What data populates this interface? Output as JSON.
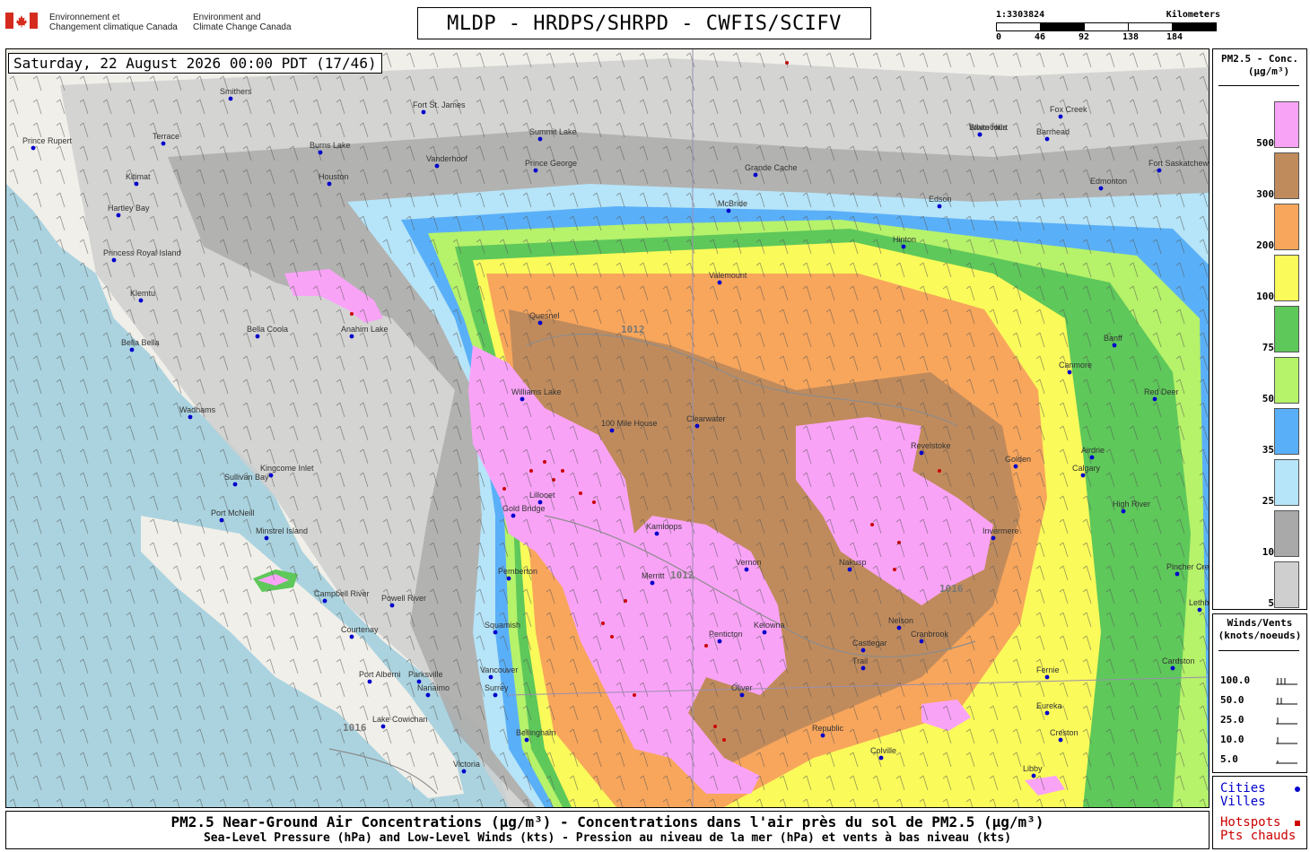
{
  "header": {
    "agency_fr_line1": "Environnement et",
    "agency_fr_line2": "Changement climatique Canada",
    "agency_en_line1": "Environment and",
    "agency_en_line2": "Climate Change Canada",
    "title": "MLDP - HRDPS/SHRPD - CWFIS/SCIFV"
  },
  "scale_bar": {
    "ratio": "1:3303824",
    "unit": "Kilometers",
    "ticks": [
      "0",
      "46",
      "92",
      "138",
      "184"
    ]
  },
  "timestamp": "Saturday, 22 August 2026 00:00 PDT (17/46)",
  "legend": {
    "title_line1": "PM2.5 - Conc.",
    "title_line2": "(µg/m³)",
    "bins": [
      {
        "label": "500",
        "color": "#f9a3f7"
      },
      {
        "label": "300",
        "color": "#c08b5c"
      },
      {
        "label": "200",
        "color": "#f8a65c"
      },
      {
        "label": "100",
        "color": "#fafa5a"
      },
      {
        "label": "75",
        "color": "#5ec85a"
      },
      {
        "label": "50",
        "color": "#b6f26a"
      },
      {
        "label": "35",
        "color": "#5ab0f8"
      },
      {
        "label": "25",
        "color": "#b6e4f8"
      },
      {
        "label": "10",
        "color": "#a9a9a9"
      },
      {
        "label": "5",
        "color": "#cfcfcf"
      }
    ]
  },
  "winds_legend": {
    "title_line1": "Winds/Vents",
    "title_line2": "(knots/noeuds)",
    "rows": [
      "100.0",
      "50.0",
      "25.0",
      "10.0",
      "5.0"
    ]
  },
  "keys": {
    "cities_en": "Cities",
    "cities_fr": "Villes",
    "cities_color": "#0000cc",
    "hotspots_en": "Hotspots",
    "hotspots_fr": "Pts chauds",
    "hotspots_color": "#cc0000"
  },
  "caption": {
    "line1": "PM2.5 Near-Ground Air Concentrations (µg/m³) - Concentrations dans l'air près du sol de PM2.5 (µg/m³)",
    "line2": "Sea-Level Pressure (hPa) and Low-Level Winds (kts) - Pression au niveau de la mer (hPa) et vents à bas niveau (kts)"
  },
  "map": {
    "places": [
      "Prince Rupert",
      "Terrace",
      "Kitimat",
      "Hartley Bay",
      "Princess Royal Island",
      "Klemtu",
      "Bella Bella",
      "Bella Coola",
      "Anahim Lake",
      "Wadhams",
      "Port McNeill",
      "Sullivan Bay",
      "Kingcome Inlet",
      "Minstrel Island",
      "Campbell River",
      "Powell River",
      "Courtenay",
      "Port Alberni",
      "Parksville",
      "Nanaimo",
      "Lake Cowichan",
      "Victoria",
      "Vancouver",
      "Surrey",
      "Bellingham",
      "Squamish",
      "Pemberton",
      "Gold Bridge",
      "Lillooet",
      "Williams Lake",
      "Quesnel",
      "Prince George",
      "Vanderhoof",
      "Fort St. James",
      "Burns Lake",
      "Houston",
      "Smithers",
      "Summit Lake",
      "McBride",
      "Valemount",
      "Grande Cache",
      "Edmonton",
      "Fort Saskatchewan",
      "Barrhead",
      "Edson",
      "Hinton",
      "Whitecourt",
      "Swan Hills",
      "Fox Creek",
      "Red Deer",
      "Calgary",
      "Airdrie",
      "High River",
      "Lethbridge",
      "Cardston",
      "Pincher Creek",
      "Clearwater",
      "100 Mile House",
      "Kamloops",
      "Merritt",
      "Vernon",
      "Kelowna",
      "Penticton",
      "Oliver",
      "Revelstoke",
      "Golden",
      "Invermere",
      "Nakusp",
      "Nelson",
      "Trail",
      "Castlegar",
      "Cranbrook",
      "Fernie",
      "Creston",
      "Republic",
      "Colville",
      "Eureka",
      "Libby",
      "Banff",
      "Canmore"
    ],
    "isobars": [
      "1012",
      "1016"
    ]
  }
}
